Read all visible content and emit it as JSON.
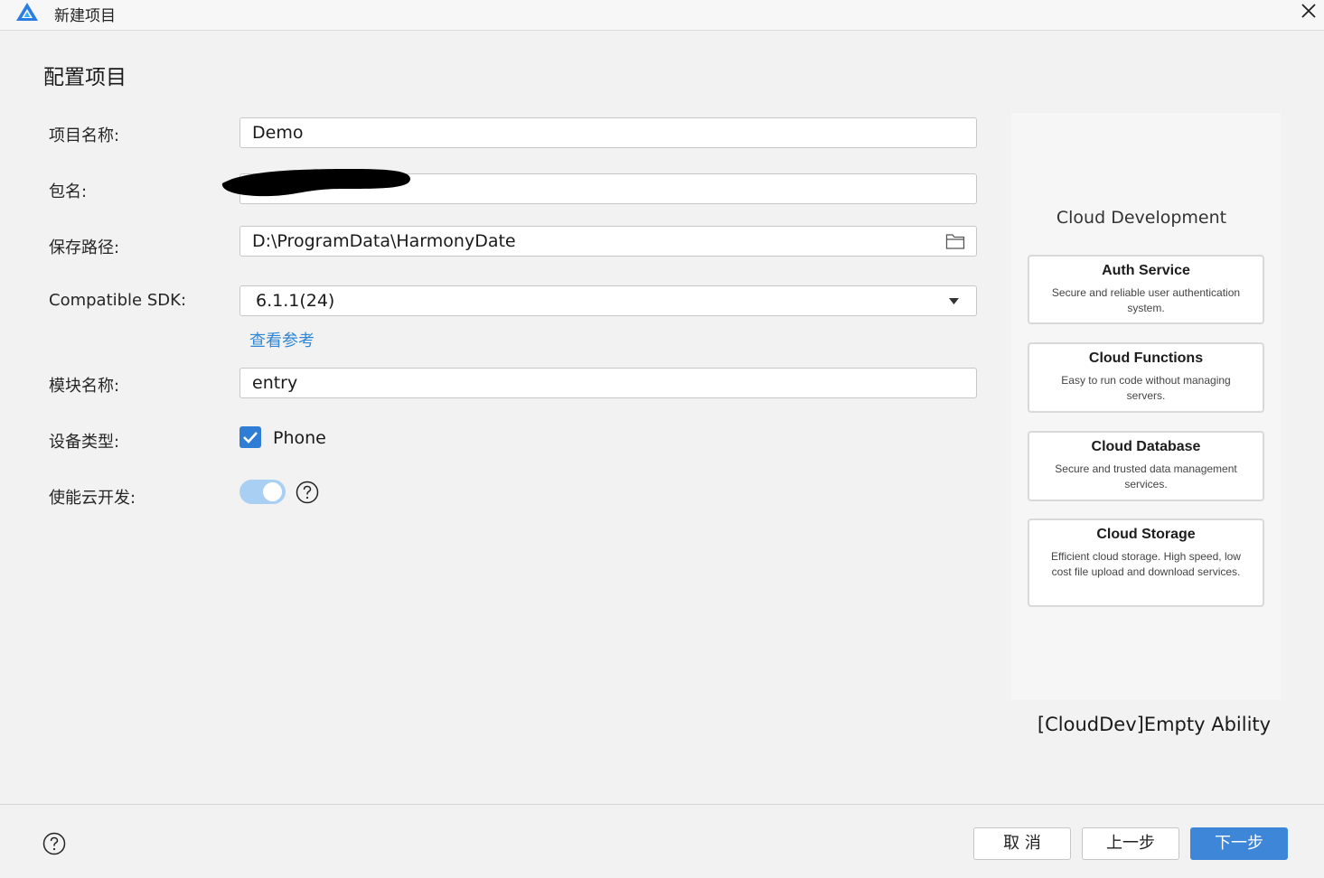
{
  "window": {
    "title": "新建项目"
  },
  "page": {
    "title": "配置项目"
  },
  "form": {
    "project_name": {
      "label": "项目名称:",
      "value": "Demo"
    },
    "package_name": {
      "label": "包名:",
      "value": ""
    },
    "save_path": {
      "label": "保存路径:",
      "value": "D:\\ProgramData\\HarmonyDate"
    },
    "compatible_sdk": {
      "label": "Compatible SDK:",
      "value": "6.1.1(24)",
      "reference_link": "查看参考"
    },
    "module_name": {
      "label": "模块名称:",
      "value": "entry"
    },
    "device_type": {
      "label": "设备类型:",
      "option": "Phone",
      "checked": true
    },
    "cloud_dev": {
      "label": "使能云开发:",
      "enabled": true
    }
  },
  "template": {
    "panel_title": "Cloud Development",
    "cards": [
      {
        "title": "Auth Service",
        "description": "Secure and reliable user authentication system."
      },
      {
        "title": "Cloud Functions",
        "description": "Easy to run code without managing servers."
      },
      {
        "title": "Cloud Database",
        "description": "Secure and trusted data management services."
      },
      {
        "title": "Cloud Storage",
        "description": "Efficient cloud storage. High speed, low cost file upload and download services."
      }
    ],
    "name": "[CloudDev]Empty Ability"
  },
  "footer": {
    "cancel": "取 消",
    "previous": "上一步",
    "next": "下一步"
  },
  "colors": {
    "accent": "#3d86d8",
    "link": "#2f87d6",
    "toggle_on": "#a9cff2"
  },
  "icons": [
    "app-logo-icon",
    "close-icon",
    "folder-icon",
    "dropdown-arrow-icon",
    "checkmark-icon",
    "help-icon"
  ]
}
